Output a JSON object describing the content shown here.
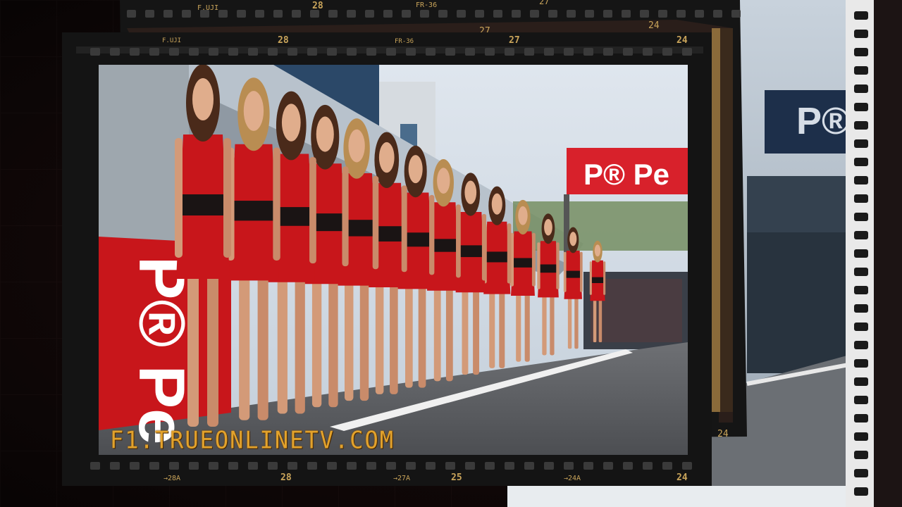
{
  "watermark": "F1.TRUEONLINETV.COM",
  "billboard": {
    "main_text": "P® Pe",
    "back_text": "P®",
    "side_text": "P® Pe"
  },
  "film_numbers": {
    "top_back": [
      "F.UJI",
      "28",
      "FR-36",
      "27",
      "24"
    ],
    "top_mid": [
      "F.UJI",
      "28",
      "FR-36",
      "27",
      "24"
    ],
    "top_front": [
      "27",
      "27",
      "24"
    ],
    "bottom": [
      "→28A",
      "28",
      "→27A",
      "25",
      "→24A",
      "24"
    ],
    "right_bottom": "24"
  },
  "colors": {
    "uniform_red": "#c8161b",
    "film_black": "#141414",
    "watermark": "#e2a22c",
    "sky": "#cdd8e2",
    "track": "#5a5a5e"
  }
}
